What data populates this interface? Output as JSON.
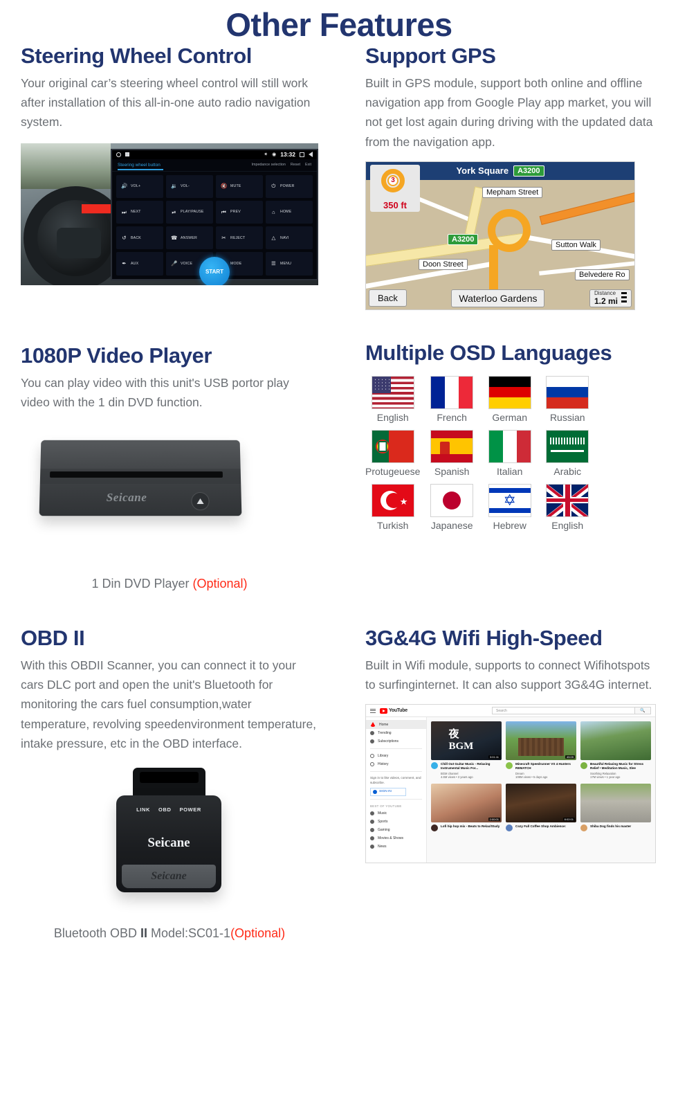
{
  "page": {
    "title": "Other Features"
  },
  "features": [
    {
      "id": "steering-wheel-control",
      "heading": "Steering Wheel Control",
      "body": "Your original car’s steering wheel control will still work after installation of this all-in-one auto radio navigation system."
    },
    {
      "id": "support-gps",
      "heading": "Support GPS",
      "body": "Built in GPS module, support both online and offline navigation app from Google Play app market, you will not get lost again during driving with the updated data from the navigation app."
    },
    {
      "id": "video-player",
      "heading": "1080P Video Player",
      "body": "You can play video with this unit's  USB portor play video with the 1 din DVD function."
    },
    {
      "id": "osd-languages",
      "heading": "Multiple OSD Languages",
      "body": ""
    },
    {
      "id": "obd-ii",
      "heading": "OBD II",
      "body": "With this OBDII Scanner, you can connect it to your cars DLC port and open the unit's Bluetooth for monitoring the cars fuel consumption,water temperature, revolving speedenvironment temperature, intake pressure, etc in the OBD interface."
    },
    {
      "id": "wifi",
      "heading": "3G&4G Wifi High-Speed",
      "body": "Built in Wifi module, supports to connect  Wifihotspots to surfinginternet. It can also support 3G&4G internet."
    }
  ],
  "steering_screen": {
    "status": {
      "time": "13:32",
      "bluetooth": "✶",
      "location": "◉"
    },
    "tab": "Steering wheel button",
    "tools": [
      "Impedance selection",
      "Reset",
      "Exit"
    ],
    "buttons": [
      {
        "icon": "🔊",
        "label": "VOL+"
      },
      {
        "icon": "🔉",
        "label": "VOL-"
      },
      {
        "icon": "🔇",
        "label": "MUTE"
      },
      {
        "icon": "⏻",
        "label": "POWER"
      },
      {
        "icon": "⏭",
        "label": "NEXT"
      },
      {
        "icon": "⏯",
        "label": "PLAY/PAUSE"
      },
      {
        "icon": "⏮",
        "label": "PREV"
      },
      {
        "icon": "⌂",
        "label": "HOME"
      },
      {
        "icon": "↺",
        "label": "BACK"
      },
      {
        "icon": "☎",
        "label": "ANSWER"
      },
      {
        "icon": "✂",
        "label": "REJECT"
      },
      {
        "icon": "△",
        "label": "NAVI"
      },
      {
        "icon": "✒",
        "label": "AUX"
      },
      {
        "icon": "🎤",
        "label": "VOICE"
      },
      {
        "icon": "M",
        "label": "MODE"
      },
      {
        "icon": "☰",
        "label": "MENU"
      }
    ],
    "start_label": "START"
  },
  "gps_screen": {
    "title": "York Square",
    "title_road": "A3200",
    "turn": {
      "exit_number": "3",
      "distance": "350 ft"
    },
    "map_road_badge": "A3200",
    "street_labels": [
      "Mepham Street",
      "Sutton Walk",
      "Doon Street",
      "Belvedere Ro"
    ],
    "back_label": "Back",
    "destination": "Waterloo Gardens",
    "distance_label": "Distance",
    "distance_value": "1.2 mi"
  },
  "dvd": {
    "brand": "Seicane",
    "caption_main": "1 Din DVD Player ",
    "caption_optional": "(Optional)"
  },
  "languages": [
    {
      "name": "English",
      "flag": "us"
    },
    {
      "name": "French",
      "flag": "fr"
    },
    {
      "name": "German",
      "flag": "de"
    },
    {
      "name": "Russian",
      "flag": "ru"
    },
    {
      "name": "Protugeuese",
      "flag": "pt"
    },
    {
      "name": "Spanish",
      "flag": "es"
    },
    {
      "name": "Italian",
      "flag": "it"
    },
    {
      "name": "Arabic",
      "flag": "sa"
    },
    {
      "name": "Turkish",
      "flag": "tr"
    },
    {
      "name": "Japanese",
      "flag": "jp"
    },
    {
      "name": "Hebrew",
      "flag": "il"
    },
    {
      "name": "English",
      "flag": "gb"
    }
  ],
  "obd": {
    "leds": [
      "LINK",
      "OBD",
      "POWER"
    ],
    "brand": "Seicane",
    "foot_brand": "Seicane",
    "caption_main": "Bluetooth OBD ",
    "caption_roman": "II",
    "caption_model": " Model:SC01-1",
    "caption_optional": "(Optional)"
  },
  "youtube": {
    "logo": "YouTube",
    "search_placeholder": "Search",
    "search_icon": "🔍",
    "nav": [
      {
        "label": "Home",
        "active": true
      },
      {
        "label": "Trending",
        "active": false
      },
      {
        "label": "Subscriptions",
        "active": false
      }
    ],
    "nav2": [
      {
        "label": "Library"
      },
      {
        "label": "History"
      }
    ],
    "signin_note": "Sign in to like videos, comment, and subscribe.",
    "signin_button": "SIGN IN",
    "best_header": "BEST OF YOUTUBE",
    "categories": [
      "Music",
      "Sports",
      "Gaming",
      "Movies & Shows",
      "News"
    ],
    "videos": [
      {
        "title": "Chill Out Guitar Music - Relaxing Instrumental Music For...",
        "channel": "BGM channel",
        "views": "4.6M views • 3 years ago",
        "duration": "3:01:11",
        "thumb": "th1",
        "avatar": "av1"
      },
      {
        "title": "Minecraft Speedrunner VS 4 Hunters REMATCH",
        "channel": "Dream",
        "views": "108M views • 5 days ago",
        "duration": "45:09",
        "thumb": "th2",
        "avatar": "av2"
      },
      {
        "title": "Beautiful Relaxing Music for Stress Relief • Meditation Music, Slee",
        "channel": "Soothing Relaxation",
        "views": "17M views • 1 year ago",
        "duration": "",
        "thumb": "th3",
        "avatar": "av3"
      },
      {
        "title": "Lofi hip hop mix - Beats to Relax/Study",
        "channel": "",
        "views": "",
        "duration": "2:00:01",
        "thumb": "th4",
        "avatar": "av4"
      },
      {
        "title": "Cozy Fall Coffee Shop Ambience:",
        "channel": "",
        "views": "",
        "duration": "8:02:01",
        "thumb": "th5",
        "avatar": "av5"
      },
      {
        "title": "Shiba Dog finds his master",
        "channel": "",
        "views": "",
        "duration": "",
        "thumb": "th6",
        "avatar": "av6"
      }
    ]
  },
  "colors": {
    "heading": "#22356f",
    "body": "#6b6f74",
    "optional": "#ff2a17"
  }
}
